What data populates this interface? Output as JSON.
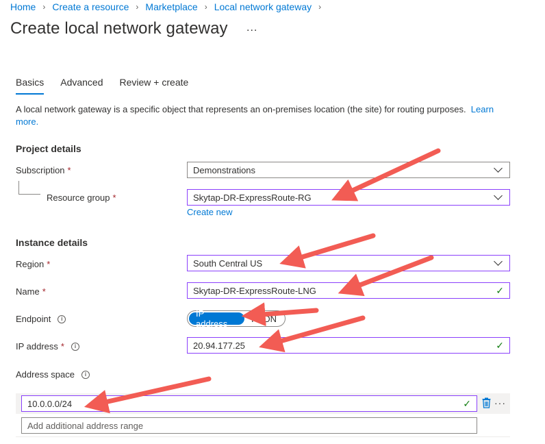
{
  "breadcrumb": [
    {
      "label": "Home"
    },
    {
      "label": "Create a resource"
    },
    {
      "label": "Marketplace"
    },
    {
      "label": "Local network gateway"
    }
  ],
  "page": {
    "title": "Create local network gateway",
    "more": "..."
  },
  "tabs": [
    {
      "label": "Basics",
      "active": true
    },
    {
      "label": "Advanced",
      "active": false
    },
    {
      "label": "Review + create",
      "active": false
    }
  ],
  "description": {
    "text": "A local network gateway is a specific object that represents an on-premises location (the site) for routing purposes.",
    "link_label": "Learn more."
  },
  "project_details": {
    "title": "Project details",
    "subscription": {
      "label": "Subscription",
      "required": "*",
      "value": "Demonstrations"
    },
    "resource_group": {
      "label": "Resource group",
      "required": "*",
      "value": "Skytap-DR-ExpressRoute-RG"
    },
    "create_new": "Create new"
  },
  "instance_details": {
    "title": "Instance details",
    "region": {
      "label": "Region",
      "required": "*",
      "value": "South Central US"
    },
    "name": {
      "label": "Name",
      "required": "*",
      "value": "Skytap-DR-ExpressRoute-LNG"
    },
    "endpoint": {
      "label": "Endpoint",
      "options": [
        "IP address",
        "FQDN"
      ],
      "selected": "IP address"
    },
    "ip_address": {
      "label": "IP address",
      "required": "*",
      "value": "20.94.177.25"
    },
    "address_space": {
      "label": "Address space",
      "value": "10.0.0.0/24",
      "placeholder": "Add additional address range"
    }
  },
  "icons": {
    "check": "✓",
    "info": "i",
    "trash": "🗑",
    "separator": "›",
    "row_more": "···"
  },
  "colors": {
    "accent": "#0078d4",
    "focus_border": "#8a3ffc",
    "success": "#107c10",
    "arrow": "#f25c54"
  }
}
